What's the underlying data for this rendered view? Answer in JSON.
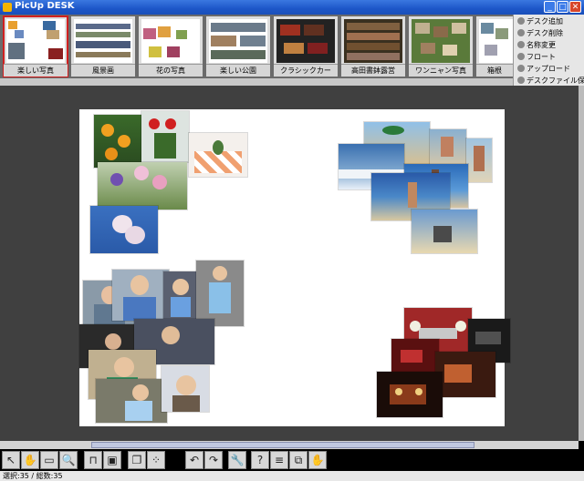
{
  "window": {
    "title": "PicUp DESK",
    "minimize_icon": "minimize-icon",
    "maximize_icon": "maximize-icon",
    "close_icon": "close-icon"
  },
  "thumbnails": [
    {
      "label": "楽しい写真",
      "selected": true
    },
    {
      "label": "風景画",
      "selected": false
    },
    {
      "label": "花の写真",
      "selected": false
    },
    {
      "label": "楽しい公園",
      "selected": false
    },
    {
      "label": "クラシックカー",
      "selected": false
    },
    {
      "label": "高田書鉢露営",
      "selected": false
    },
    {
      "label": "ワンニャン写真",
      "selected": false
    },
    {
      "label": "箱根",
      "selected": false
    }
  ],
  "menu": [
    {
      "label": "デスク追加",
      "icon": "add-icon"
    },
    {
      "label": "デスク削除",
      "icon": "delete-icon"
    },
    {
      "label": "名称変更",
      "icon": "rename-icon"
    },
    {
      "label": "フロート",
      "icon": "float-icon"
    },
    {
      "label": "アップロード",
      "icon": "upload-icon"
    },
    {
      "label": "デスクファイル保存",
      "icon": "save-icon"
    }
  ],
  "toolbar": [
    {
      "icon": "pointer-icon",
      "glyph": "↖"
    },
    {
      "icon": "hand-icon",
      "glyph": "✋"
    },
    {
      "icon": "eraser-icon",
      "glyph": "▭"
    },
    {
      "icon": "zoom-icon",
      "glyph": "🔍"
    },
    {
      "icon": "table-icon",
      "glyph": "⊓"
    },
    {
      "icon": "monitor-icon",
      "glyph": "▣"
    },
    {
      "icon": "layers-icon",
      "glyph": "❐"
    },
    {
      "icon": "scatter-icon",
      "glyph": "⁘"
    },
    {
      "icon": "undo-icon",
      "glyph": "↶"
    },
    {
      "icon": "redo-icon",
      "glyph": "↷"
    },
    {
      "icon": "wrench-icon",
      "glyph": "🔧"
    },
    {
      "icon": "help-icon",
      "glyph": "?"
    },
    {
      "icon": "list-icon",
      "glyph": "≡"
    },
    {
      "icon": "export-icon",
      "glyph": "⧉"
    },
    {
      "icon": "stop-hand-icon",
      "glyph": "✋"
    }
  ],
  "status": {
    "text": "選択:35 / 総数:35"
  },
  "colors": {
    "title_bar": "#1d56c8",
    "desk_background": "#404040",
    "selected_outline": "#d02020"
  }
}
